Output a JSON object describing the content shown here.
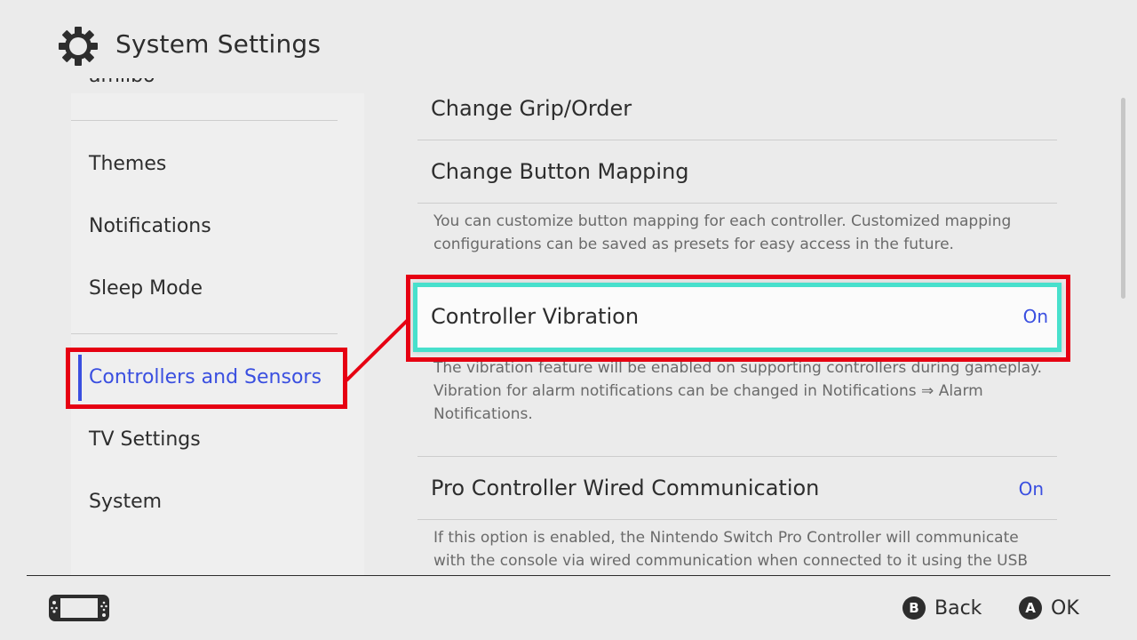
{
  "header": {
    "title": "System Settings",
    "icon": "gear-icon"
  },
  "sidebar": {
    "items": [
      {
        "label": "amiibo",
        "selected": false
      },
      {
        "label": "Themes",
        "selected": false
      },
      {
        "label": "Notifications",
        "selected": false
      },
      {
        "label": "Sleep Mode",
        "selected": false
      },
      {
        "label": "Controllers and Sensors",
        "selected": true
      },
      {
        "label": "TV Settings",
        "selected": false
      },
      {
        "label": "System",
        "selected": false
      }
    ]
  },
  "main": {
    "rows": [
      {
        "label": "Change Grip/Order"
      },
      {
        "label": "Change Button Mapping",
        "description": "You can customize button mapping for each controller. Customized mapping configurations can be saved as presets for easy access in the future."
      },
      {
        "label": "Controller Vibration",
        "value": "On",
        "description": "The vibration feature will be enabled on supporting controllers during gameplay. Vibration for alarm notifications can be changed in Notifications ⇒ Alarm Notifications."
      },
      {
        "label": "Pro Controller Wired Communication",
        "value": "On",
        "description": "If this option is enabled, the Nintendo Switch Pro Controller will communicate with the console via wired communication when connected to it using the USB"
      }
    ]
  },
  "footer": {
    "back": {
      "button": "B",
      "label": "Back"
    },
    "ok": {
      "button": "A",
      "label": "OK"
    }
  },
  "colors": {
    "accent": "#3a4fe0",
    "focus_border": "#48e0cc",
    "annotation": "#e60012",
    "background": "#ebebeb"
  }
}
